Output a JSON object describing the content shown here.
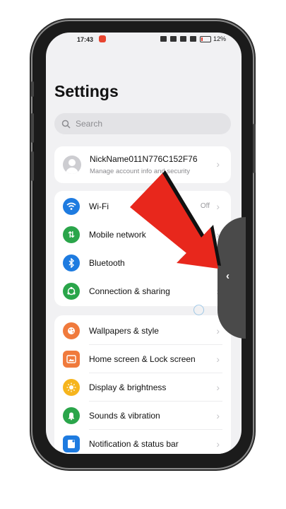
{
  "status_bar": {
    "time": "17:43",
    "battery": "12%"
  },
  "header": {
    "title": "Settings"
  },
  "search": {
    "placeholder": "Search"
  },
  "account": {
    "name": "NickName011N776C152F76",
    "subtitle": "Manage account info and security"
  },
  "connections": {
    "items": [
      {
        "label": "Wi-Fi",
        "value": "Off",
        "icon": "wifi-icon",
        "color": "#1e7be0"
      },
      {
        "label": "Mobile network",
        "value": "",
        "icon": "mobile-network-icon",
        "color": "#2aa54a"
      },
      {
        "label": "Bluetooth",
        "value": "",
        "icon": "bluetooth-icon",
        "color": "#1e7be0"
      },
      {
        "label": "Connection & sharing",
        "value": "",
        "icon": "connection-sharing-icon",
        "color": "#2aa54a"
      }
    ]
  },
  "display": {
    "items": [
      {
        "label": "Wallpapers & style",
        "icon": "wallpaper-icon",
        "color": "#f07a3c"
      },
      {
        "label": "Home screen & Lock screen",
        "icon": "home-screen-icon",
        "color": "#f07a3c"
      },
      {
        "label": "Display & brightness",
        "icon": "brightness-icon",
        "color": "#f6b51d"
      },
      {
        "label": "Sounds & vibration",
        "icon": "sound-icon",
        "color": "#2aa54a"
      },
      {
        "label": "Notification & status bar",
        "icon": "notification-icon",
        "color": "#1e7be0"
      }
    ]
  },
  "overlay": {
    "arrow_color": "#e8271c",
    "side_tab_color": "#4a4a4a"
  }
}
